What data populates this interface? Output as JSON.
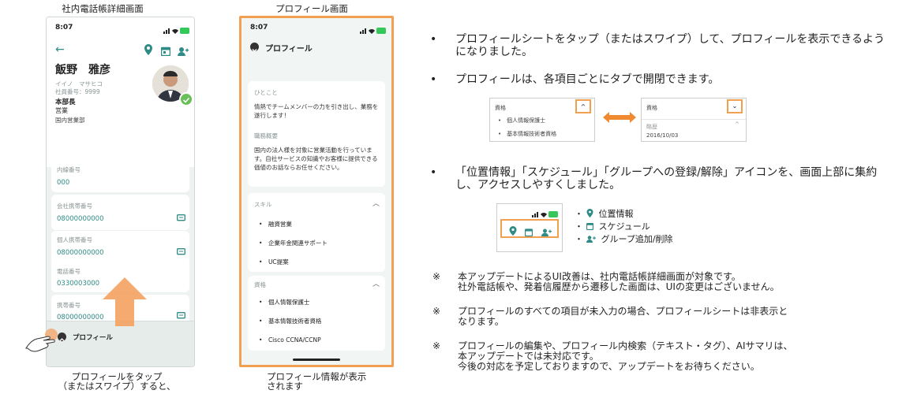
{
  "captions": {
    "left_title": "社内電話帳詳細画面",
    "middle_title": "プロフィール画面",
    "left_bottom_1": "プロフィールをタップ",
    "left_bottom_2": "（またはスワイプ）すると、",
    "middle_bottom_1": "プロフィール情報が表示",
    "middle_bottom_2": "されます"
  },
  "phone1": {
    "time": "8:07",
    "name": "飯野　雅彦",
    "kana": "イイノ　マサヒコ",
    "emp_no": "社員番号：9999",
    "division": "本部長",
    "dept": "営業",
    "section": "国内営業部",
    "fields": [
      {
        "label": "内線番号",
        "value": "000"
      },
      {
        "label": "会社携帯番号",
        "value": "08000000000"
      },
      {
        "label": "個人携帯番号",
        "value": "08000000000"
      },
      {
        "label": "電話番号",
        "value": "0330003000"
      },
      {
        "label": "携帯番号",
        "value": "08000000000"
      }
    ],
    "profile_tab": "プロフィール"
  },
  "phone2": {
    "time": "8:07",
    "header": "プロフィール",
    "hitokoto_label": "ひとこと",
    "hitokoto_text": "情熱でチームメンバーの力を引き出し、業務を遂行します！",
    "job_label": "職務概要",
    "job_text": "国内の法人様を対象に営業活動を行っています。自社サービスの知識やお客様に提供できる価値のお話ならお任せください。",
    "skill_label": "スキル",
    "skills": [
      "融資営業",
      "企業年金関連サポート",
      "UC提案"
    ],
    "qual_label": "資格",
    "quals": [
      "個人情報保護士",
      "基本情報技術者資格",
      "Cisco CCNA/CCNP"
    ]
  },
  "bullets": [
    "プロフィールシートをタップ（またはスワイプ）して、プロフィールを表示できるようになりました。",
    "プロフィールは、各項目ごとにタブで開閉できます。",
    "「位置情報」「スケジュール」「グループへの登録/解除」アイコンを、画面上部に集約し、アクセスしやすくしました。"
  ],
  "tab_demo": {
    "left_label": "資格",
    "left_items": [
      "個人情報保護士",
      "基本情報技術者資格"
    ],
    "right_label": "資格",
    "right_sub_label": "略歴",
    "right_date": "2016/10/03"
  },
  "icon_legend": {
    "location": "位置情報",
    "schedule": "スケジュール",
    "group": "グループ追加/削除"
  },
  "notes": [
    {
      "mark": "※",
      "lines": [
        "本アップデートによるUI改善は、社内電話帳詳細画面が対象です。",
        "社外電話帳や、発着信履歴から遷移した画面は、UIの変更はございません。"
      ]
    },
    {
      "mark": "※",
      "lines": [
        "プロフィールのすべての項目が未入力の場合、プロフィールシートは非表示と",
        "なります。"
      ]
    },
    {
      "mark": "※",
      "lines": [
        "プロフィールの編集や、プロフィール内検索（テキスト・タグ）、AIサマリは、",
        "本アップデートでは未対応です。",
        "今後の対応を予定しておりますので、アップデートをお待ちください。"
      ]
    }
  ],
  "colors": {
    "teal": "#2e8b86",
    "orange": "#f0a050",
    "phone_bg": "#eef3f2"
  }
}
